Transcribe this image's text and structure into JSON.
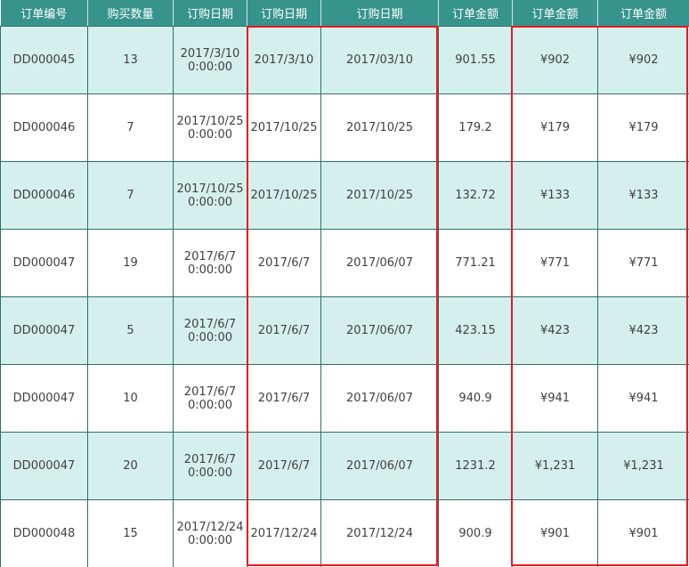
{
  "table": {
    "headers": [
      "订单编号",
      "购买数量",
      "订购日期",
      "订购日期",
      "订购日期",
      "订单金额",
      "订单金额",
      "订单金额"
    ],
    "rows": [
      {
        "id": "DD000045",
        "qty": "13",
        "date_line1": "2017/3/10",
        "date_line2": "0:00:00",
        "date_short": "2017/3/10",
        "date_padded": "2017/03/10",
        "amount": "901.55",
        "amount_yen": "¥902",
        "amount_yen2": "¥902"
      },
      {
        "id": "DD000046",
        "qty": "7",
        "date_line1": "2017/10/25",
        "date_line2": "0:00:00",
        "date_short": "2017/10/25",
        "date_padded": "2017/10/25",
        "amount": "179.2",
        "amount_yen": "¥179",
        "amount_yen2": "¥179"
      },
      {
        "id": "DD000046",
        "qty": "7",
        "date_line1": "2017/10/25",
        "date_line2": "0:00:00",
        "date_short": "2017/10/25",
        "date_padded": "2017/10/25",
        "amount": "132.72",
        "amount_yen": "¥133",
        "amount_yen2": "¥133"
      },
      {
        "id": "DD000047",
        "qty": "19",
        "date_line1": "2017/6/7",
        "date_line2": "0:00:00",
        "date_short": "2017/6/7",
        "date_padded": "2017/06/07",
        "amount": "771.21",
        "amount_yen": "¥771",
        "amount_yen2": "¥771"
      },
      {
        "id": "DD000047",
        "qty": "5",
        "date_line1": "2017/6/7",
        "date_line2": "0:00:00",
        "date_short": "2017/6/7",
        "date_padded": "2017/06/07",
        "amount": "423.15",
        "amount_yen": "¥423",
        "amount_yen2": "¥423"
      },
      {
        "id": "DD000047",
        "qty": "10",
        "date_line1": "2017/6/7",
        "date_line2": "0:00:00",
        "date_short": "2017/6/7",
        "date_padded": "2017/06/07",
        "amount": "940.9",
        "amount_yen": "¥941",
        "amount_yen2": "¥941"
      },
      {
        "id": "DD000047",
        "qty": "20",
        "date_line1": "2017/6/7",
        "date_line2": "0:00:00",
        "date_short": "2017/6/7",
        "date_padded": "2017/06/07",
        "amount": "1231.2",
        "amount_yen": "¥1,231",
        "amount_yen2": "¥1,231"
      },
      {
        "id": "DD000048",
        "qty": "15",
        "date_line1": "2017/12/24",
        "date_line2": "0:00:00",
        "date_short": "2017/12/24",
        "date_padded": "2017/12/24",
        "amount": "900.9",
        "amount_yen": "¥901",
        "amount_yen2": "¥901"
      }
    ]
  },
  "colors": {
    "header_bg": "#37948c",
    "row_alt_bg": "#d5f0ec",
    "grid_line": "#2f6f6a",
    "highlight_border": "#e8191f"
  }
}
